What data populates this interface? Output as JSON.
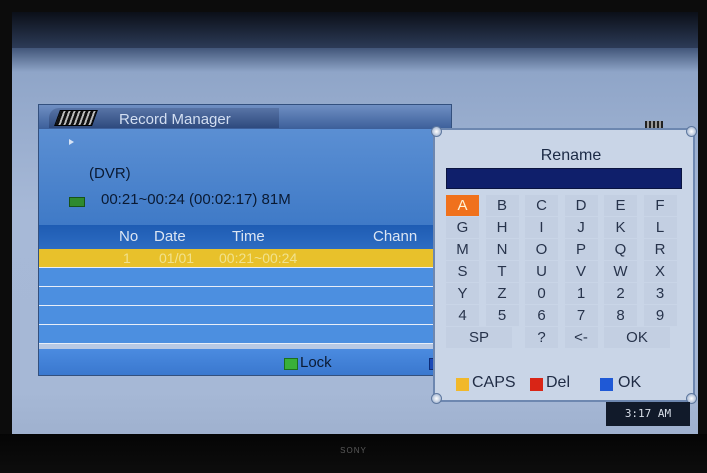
{
  "record_manager": {
    "title": "Record Manager",
    "source": "(DVR)",
    "duration_info": "00:21~00:24 (00:02:17) 81M",
    "columns": [
      "No",
      "Date",
      "Time",
      "Chann"
    ],
    "rows": [
      {
        "no": "1",
        "date": "01/01",
        "time": "00:21~00:24",
        "selected": true
      }
    ],
    "footer": {
      "lock_label": "Lock"
    }
  },
  "rename_dialog": {
    "title": "Rename",
    "input_value": "",
    "keys": [
      [
        "A",
        "B",
        "C",
        "D",
        "E",
        "F"
      ],
      [
        "G",
        "H",
        "I",
        "J",
        "K",
        "L"
      ],
      [
        "M",
        "N",
        "O",
        "P",
        "Q",
        "R"
      ],
      [
        "S",
        "T",
        "U",
        "V",
        "W",
        "X"
      ],
      [
        "Y",
        "Z",
        "0",
        "1",
        "2",
        "3"
      ],
      [
        "4",
        "5",
        "6",
        "7",
        "8",
        "9"
      ],
      [
        "SP",
        "?",
        "<-",
        "OK"
      ]
    ],
    "highlighted_key": "A",
    "legend": {
      "caps_label": "CAPS",
      "del_label": "Del",
      "ok_label": "OK"
    }
  },
  "status": {
    "clock": "3:17 AM"
  },
  "colors": {
    "highlight_key": "#f0711c",
    "selected_row": "#e8c12b",
    "caps_yellow": "#f1b82a",
    "del_red": "#d92516",
    "ok_blue": "#1f59d6",
    "lock_green": "#39b039"
  },
  "icons": {
    "film": "film-reel-icon",
    "play": "play-icon",
    "record_marker": "green-record-icon",
    "lock": "green-key-icon"
  }
}
